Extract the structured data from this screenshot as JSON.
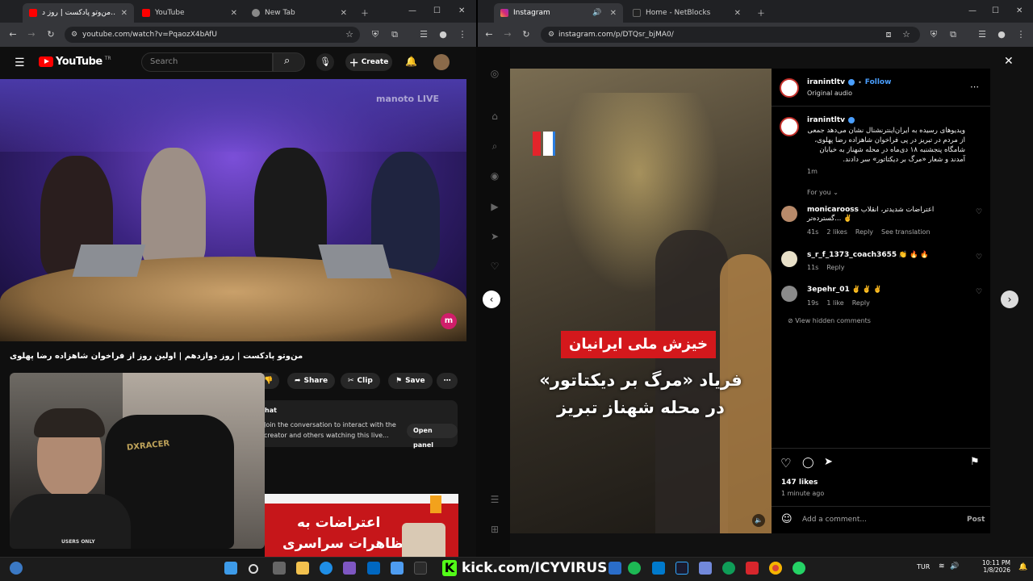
{
  "left_window": {
    "tabs": [
      {
        "label": "من‌وتو پادکست | روز د…",
        "active": true
      },
      {
        "label": "YouTube",
        "active": false
      },
      {
        "label": "New Tab",
        "active": false
      }
    ],
    "url": "youtube.com/watch?v=PqaozX4bAfU"
  },
  "youtube": {
    "logo_text": "YouTube",
    "logo_sup": "TR",
    "search_placeholder": "Search",
    "create_label": "Create",
    "channel_watermark": "manoto LIVE",
    "video_title": "من‌وتو پادکست | روز دوازدهم | اولین روز از فراخوان شاهزاده رضا پهلوی",
    "share_label": "Share",
    "clip_label": "Clip",
    "save_label": "Save",
    "chat_heading": "hat",
    "chat_text": "Join the conversation to interact with the creator and others watching this live...",
    "open_panel_label": "Open panel",
    "thumb_text_1": "اعتراضات به",
    "thumb_text_2": "تظاهرات سراسری",
    "webcam_caption": "USERS ONLY"
  },
  "right_window": {
    "tabs": [
      {
        "label": "Instagram",
        "active": true
      },
      {
        "label": "Home - NetBlocks",
        "active": false
      }
    ],
    "url": "instagram.com/p/DTQsr_bjMA0/"
  },
  "instagram": {
    "username": "iranintltv",
    "follow_label": "Follow",
    "audio_label": "Original audio",
    "caption": "ویدیوهای رسیده به ایران‌اینترنشنال نشان می‌دهد جمعی از مردم در تبریز در پی فراخوان شاهزاده رضا پهلوی، شامگاه پنجشنبه ۱۸ دی‌ماه در محله شهناز به خیابان آمدند و شعار «مرگ بر دیکتاتور» سر دادند.",
    "caption_time": "1m",
    "for_you_label": "For you",
    "media_banner": "خیزش ملی ایرانیان",
    "media_line_1": "فریاد «مرگ بر دیکتاتور»",
    "media_line_2": "در محله شهناز تبریز",
    "comments": [
      {
        "user": "monicarooss",
        "text": "اعتراضات شدیدتر، انقلاب گسترده‌تر... ✌️",
        "time": "41s",
        "likes": "2 likes",
        "reply": "Reply",
        "extra": "See translation"
      },
      {
        "user": "s_r_f_1373_coach3655",
        "text": "👏 🔥 🔥",
        "time": "11s",
        "likes": "",
        "reply": "Reply",
        "extra": ""
      },
      {
        "user": "3epehr_01",
        "text": "✌️ ✌️ ✌️",
        "time": "19s",
        "likes": "1 like",
        "reply": "Reply",
        "extra": ""
      }
    ],
    "hidden_comments_label": "View hidden comments",
    "likes_count": "147 likes",
    "post_time": "1 minute ago",
    "add_comment_placeholder": "Add a comment...",
    "post_label": "Post"
  },
  "taskbar": {
    "kick_text": "kick.com/ICYVIRUS",
    "lang": "TUR",
    "time": "10:11 PM",
    "date": "1/8/2026"
  },
  "colors": {
    "youtube_red": "#ff0000",
    "instagram_blue": "#4a9fff",
    "banner_red": "#d4181c",
    "kick_green": "#53fc18"
  }
}
